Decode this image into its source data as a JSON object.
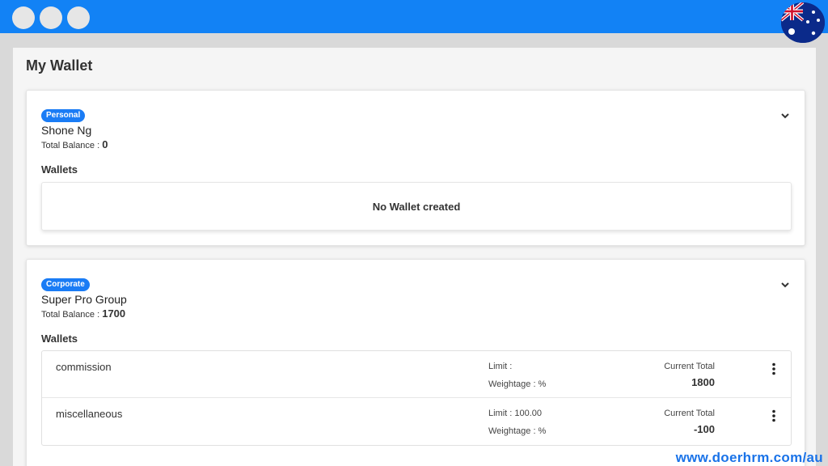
{
  "page": {
    "title": "My Wallet"
  },
  "accounts": [
    {
      "badge": "Personal",
      "name": "Shone Ng",
      "balance_label": "Total Balance :",
      "balance_value": "0",
      "wallets_heading": "Wallets",
      "empty_text": "No Wallet created"
    },
    {
      "badge": "Corporate",
      "name": "Super Pro Group",
      "balance_label": "Total Balance :",
      "balance_value": "1700",
      "wallets_heading": "Wallets",
      "wallets": [
        {
          "name": "commission",
          "limit": "Limit :",
          "weightage": "Weightage : %",
          "current_label": "Current Total",
          "current_value": "1800"
        },
        {
          "name": "miscellaneous",
          "limit": "Limit : 100.00",
          "weightage": "Weightage : %",
          "current_label": "Current Total",
          "current_value": "-100"
        }
      ]
    }
  ],
  "watermark": "www.doerhrm.com/au",
  "colors": {
    "topbar": "#1282f5",
    "badge": "#1a7cf5",
    "watermark": "#1a73e8"
  },
  "icons": [
    "window-dot-icon",
    "australia-flag-icon",
    "chevron-down-icon",
    "kebab-menu-icon"
  ]
}
